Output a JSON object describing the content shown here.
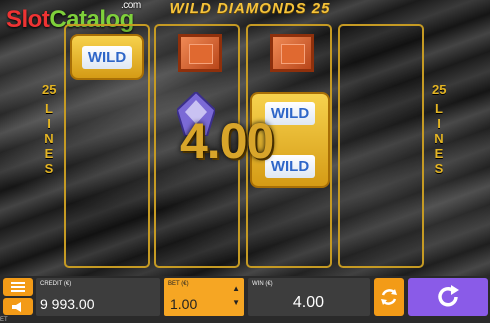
{
  "watermark": {
    "slot": "Slot",
    "catalog": "Catalog",
    "com": ".com"
  },
  "game_title": "WILD DIAMONDS 25",
  "lines_label": {
    "number": "25",
    "word": "LINES"
  },
  "symbols": {
    "wild": "WILD"
  },
  "win_display": "4.00",
  "panel": {
    "credit_label": "CREDIT (€)",
    "credit_value": "9 993.00",
    "bet_label": "BET (€)",
    "bet_value": "1.00",
    "win_label": "WIN (€)",
    "win_value": "4.00"
  },
  "corner_text": "ET",
  "colors": {
    "gold": "#d8a52a",
    "accent": "#f39b17",
    "spin": "#8a5be8"
  }
}
